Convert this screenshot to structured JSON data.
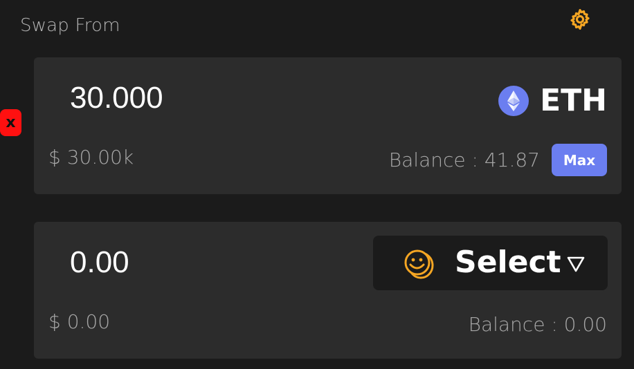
{
  "header": {
    "title": "Swap From",
    "settings_icon": "gear-icon"
  },
  "remove_badge": {
    "label": "x"
  },
  "from_card": {
    "amount": "30.000",
    "usd_value": "$ 30.00k",
    "token_symbol": "ETH",
    "token_icon": "ethereum-icon",
    "balance": "Balance : 41.87",
    "max_label": "Max"
  },
  "to_card": {
    "amount": "0.00",
    "usd_value": "$ 0.00",
    "select_label": "Select",
    "select_icon": "smiley-coin-icon",
    "balance": "Balance : 0.00"
  },
  "colors": {
    "background": "#1b1b1b",
    "card": "#2c2c2c",
    "accent": "#6b7ef0",
    "warning": "#ff1010",
    "gold": "#f5a623"
  }
}
